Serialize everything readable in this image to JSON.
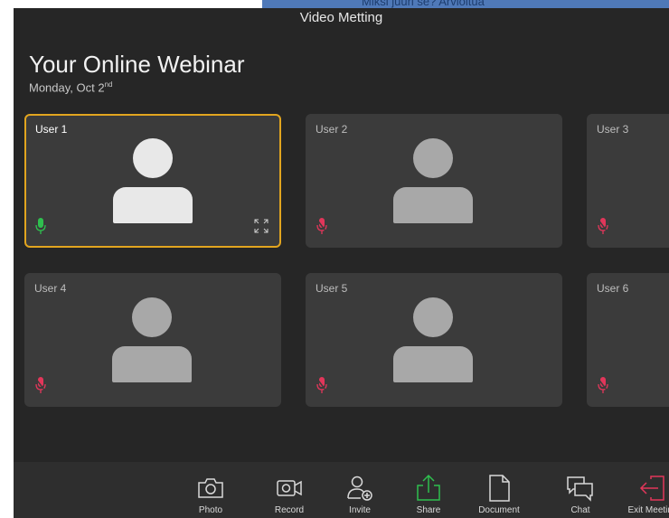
{
  "background_window": {
    "text": "Miksi juuri se? Arvioitua"
  },
  "window": {
    "title": "Video Metting"
  },
  "header": {
    "title": "Your Online Webinar",
    "date_prefix": "Monday, Oct 2",
    "date_suffix": "nd"
  },
  "participants": [
    {
      "name": "User 1",
      "mic": "on",
      "active": true
    },
    {
      "name": "User 2",
      "mic": "muted",
      "active": false
    },
    {
      "name": "User 3",
      "mic": "muted",
      "active": false
    },
    {
      "name": "User 4",
      "mic": "muted",
      "active": false
    },
    {
      "name": "User 5",
      "mic": "muted",
      "active": false
    },
    {
      "name": "User 6",
      "mic": "muted",
      "active": false
    }
  ],
  "toolbar": {
    "items": [
      {
        "label": "Photo",
        "icon": "camera-icon"
      },
      {
        "label": "Record",
        "icon": "video-camera-icon"
      },
      {
        "label": "Invite",
        "icon": "add-person-icon"
      },
      {
        "label": "Share",
        "icon": "share-upload-icon"
      },
      {
        "label": "Document",
        "icon": "document-icon"
      },
      {
        "label": "Chat",
        "icon": "chat-icon"
      },
      {
        "label": "Exit Meeting",
        "icon": "exit-icon"
      }
    ]
  },
  "colors": {
    "active_border": "#e2a51f",
    "mic_on": "#2fbf4f",
    "mic_muted": "#e2365a",
    "share_accent": "#2fbf4f",
    "exit_accent": "#e2365a"
  }
}
